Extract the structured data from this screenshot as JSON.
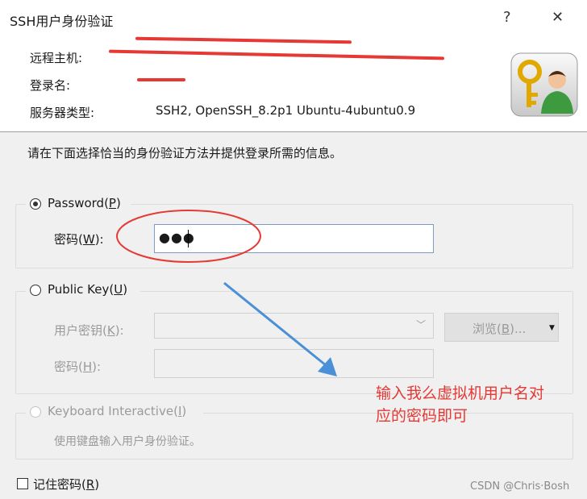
{
  "window": {
    "title": "SSH用户身份验证",
    "help": "?",
    "close": "✕"
  },
  "info": {
    "host_label": "远程主机:",
    "user_label": "登录名:",
    "server_type_label": "服务器类型:",
    "server_type": "SSH2, OpenSSH_8.2p1 Ubuntu-4ubuntu0.9"
  },
  "instruction": "请在下面选择恰当的身份验证方法并提供登录所需的信息。",
  "password_method": {
    "label_prefix": "Password(",
    "label_key": "P",
    "label_suffix": ")",
    "field_label_prefix": "密码(",
    "field_label_key": "W",
    "field_label_suffix": "):",
    "value": "●●●"
  },
  "pubkey_method": {
    "label_prefix": "Public Key(",
    "label_key": "U",
    "label_suffix": ")",
    "key_label_prefix": "用户密钥(",
    "key_label_key": "K",
    "key_label_suffix": "):",
    "browse_prefix": "浏览(",
    "browse_key": "B",
    "browse_suffix": ")...",
    "pass_label_prefix": "密码(",
    "pass_label_key": "H",
    "pass_label_suffix": "):"
  },
  "keyboard_method": {
    "label_prefix": "Keyboard Interactive(",
    "label_key": "I",
    "label_suffix": ")",
    "description": "使用键盘输入用户身份验证。"
  },
  "remember": {
    "prefix": "记住密码(",
    "key": "R",
    "suffix": ")"
  },
  "annotation": {
    "line1": "输入我么虚拟机用户名对",
    "line2": "应的密码即可"
  },
  "watermark": "CSDN @Chris·Bosh",
  "colors": {
    "annotation_red": "#e53935",
    "arrow_blue": "#4a90d9"
  }
}
